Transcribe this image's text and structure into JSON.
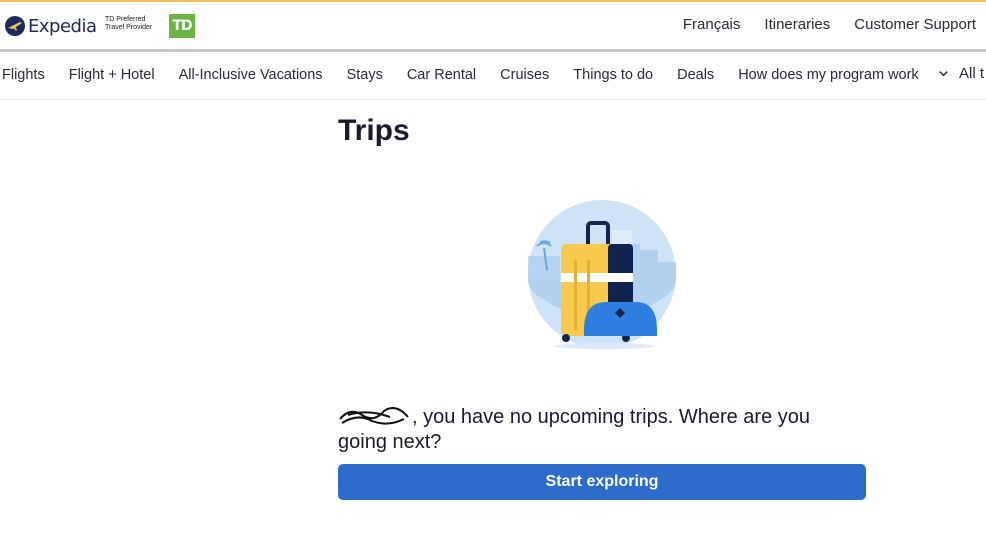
{
  "header": {
    "brand": "Expedia",
    "partner_line1": "TD Preferred",
    "partner_line2": "Travel Provider",
    "td_logo": "TD",
    "links": [
      "Français",
      "Itineraries",
      "Customer Support"
    ]
  },
  "nav": {
    "items": [
      "Flights",
      "Flight + Hotel",
      "All-Inclusive Vacations",
      "Stays",
      "Car Rental",
      "Cruises",
      "Things to do",
      "Deals",
      "How does my program work"
    ],
    "more_label": "All t"
  },
  "main": {
    "title": "Trips",
    "message": ", you have no upcoming trips. Where are you going next?",
    "cta_label": "Start exploring"
  },
  "icons": {
    "brand": "plane-globe-icon",
    "more": "chevron-down-icon",
    "illustration": "luggage-illustration"
  },
  "colors": {
    "accent_top": "#f5c24b",
    "button": "#2d6ccb",
    "td_green": "#6bb543",
    "brand_navy": "#1b2a5e"
  }
}
